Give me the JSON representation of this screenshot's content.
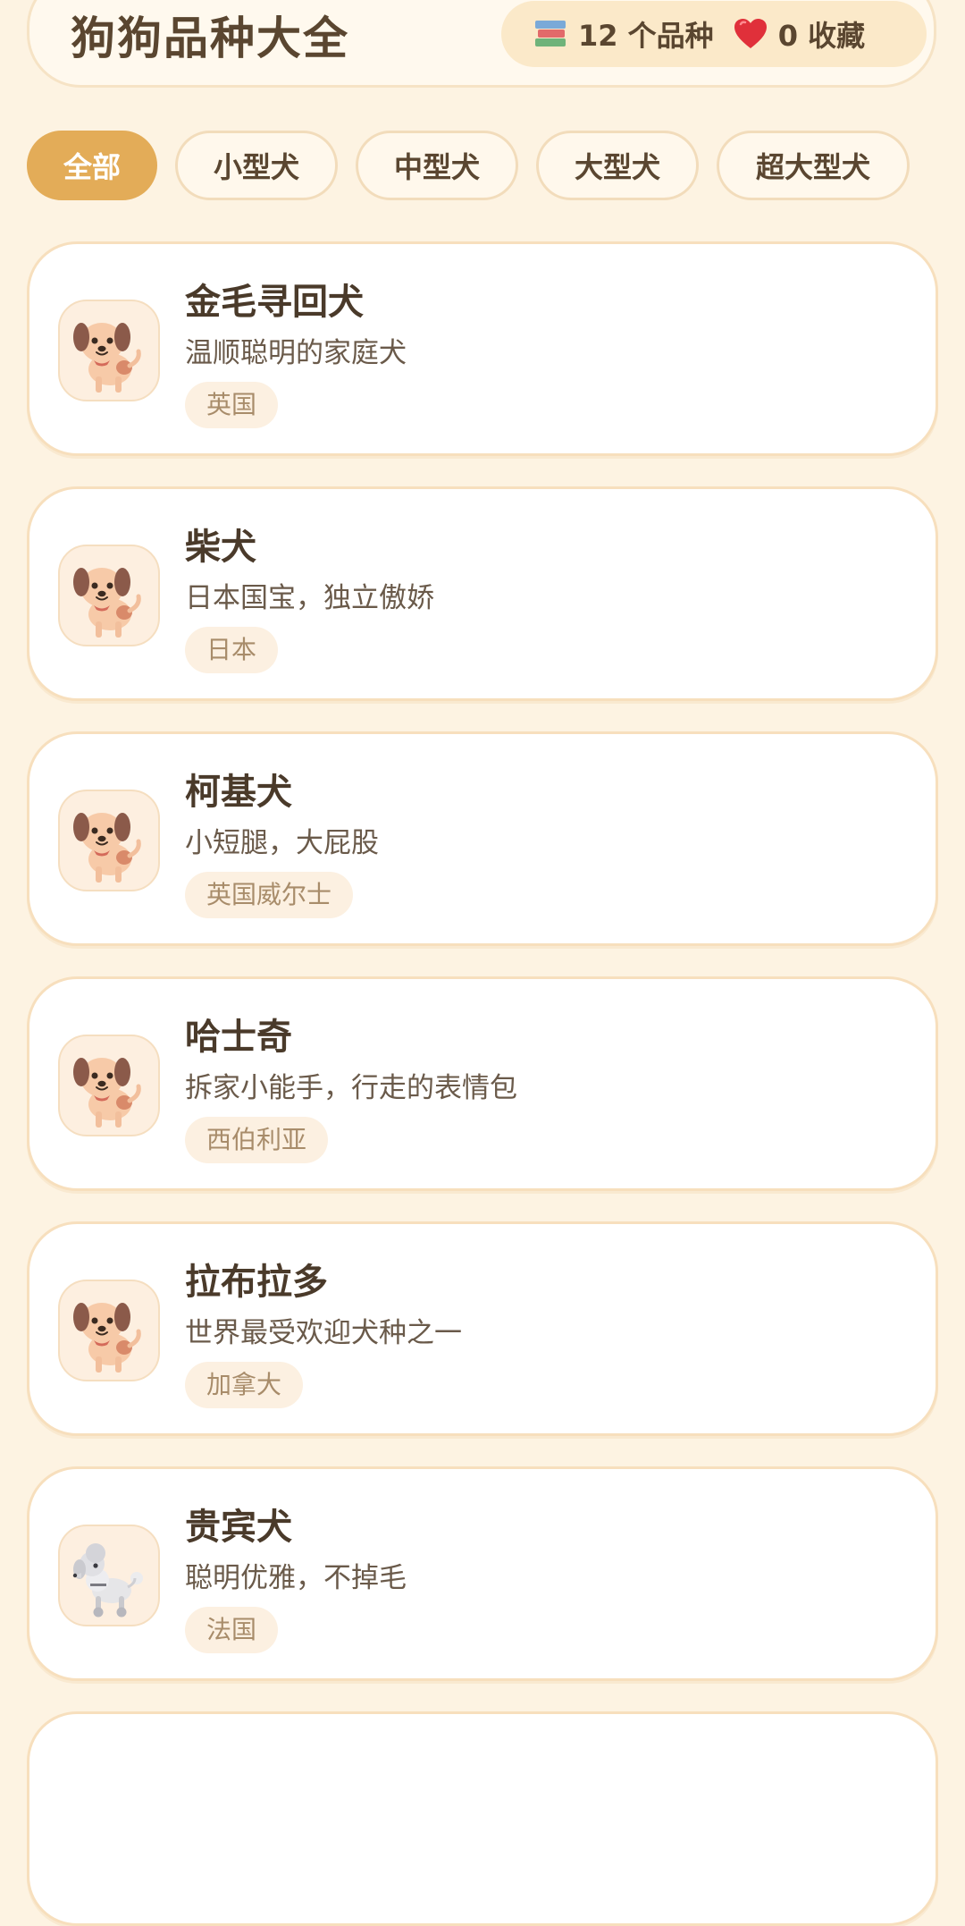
{
  "header": {
    "title": "狗狗品种大全",
    "breed_count_text": "12 个品种",
    "favorites_text": "0 收藏",
    "books_icon": "books-icon",
    "heart_icon": "heart-icon"
  },
  "filters": [
    {
      "label": "全部",
      "active": true
    },
    {
      "label": "小型犬",
      "active": false
    },
    {
      "label": "中型犬",
      "active": false
    },
    {
      "label": "大型犬",
      "active": false
    },
    {
      "label": "超大型犬",
      "active": false
    }
  ],
  "breeds": [
    {
      "name": "金毛寻回犬",
      "description": "温顺聪明的家庭犬",
      "origin": "英国",
      "icon": "dog-icon"
    },
    {
      "name": "柴犬",
      "description": "日本国宝，独立傲娇",
      "origin": "日本",
      "icon": "dog-icon"
    },
    {
      "name": "柯基犬",
      "description": "小短腿，大屁股",
      "origin": "英国威尔士",
      "icon": "dog-icon"
    },
    {
      "name": "哈士奇",
      "description": "拆家小能手，行走的表情包",
      "origin": "西伯利亚",
      "icon": "dog-icon"
    },
    {
      "name": "拉布拉多",
      "description": "世界最受欢迎犬种之一",
      "origin": "加拿大",
      "icon": "dog-icon"
    },
    {
      "name": "贵宾犬",
      "description": "聪明优雅，不掉毛",
      "origin": "法国",
      "icon": "poodle-icon"
    }
  ],
  "colors": {
    "background": "#fdf3e2",
    "accent": "#e3ac58",
    "card_border": "#f7dfbd",
    "tag_background": "#fcf0e1"
  }
}
